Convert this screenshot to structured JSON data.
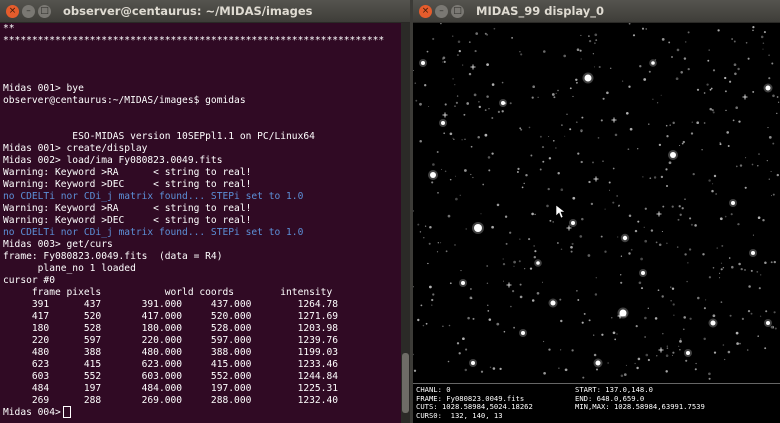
{
  "terminal": {
    "title": "observer@centaurus: ~/MIDAS/images",
    "buttons": {
      "close": "×",
      "minimize": "–",
      "maximize": "□"
    },
    "lines": [
      {
        "text": "**",
        "style": "white"
      },
      {
        "text": "******************************************************************",
        "style": "white"
      },
      {
        "text": "",
        "style": "white"
      },
      {
        "text": "",
        "style": "white"
      },
      {
        "text": "",
        "style": "white"
      },
      {
        "text": "Midas 001> bye",
        "style": "white"
      },
      {
        "text": "observer@centaurus:~/MIDAS/images$ gomidas",
        "style": "white"
      },
      {
        "text": "",
        "style": "white"
      },
      {
        "text": "",
        "style": "white"
      },
      {
        "text": "            ESO-MIDAS version 10SEPpl1.1 on PC/Linux64",
        "style": "white"
      },
      {
        "text": "Midas 001> create/display",
        "style": "white"
      },
      {
        "text": "Midas 002> load/ima Fy080823.0049.fits",
        "style": "white"
      },
      {
        "text": "Warning: Keyword >RA      < string to real!",
        "style": "white"
      },
      {
        "text": "Warning: Keyword >DEC     < string to real!",
        "style": "white"
      },
      {
        "text": "no CDELTi nor CDi_j matrix found... STEPi set to 1.0",
        "style": "blue"
      },
      {
        "text": "Warning: Keyword >RA      < string to real!",
        "style": "white"
      },
      {
        "text": "Warning: Keyword >DEC     < string to real!",
        "style": "white"
      },
      {
        "text": "no CDELTi nor CDi_j matrix found... STEPi set to 1.0",
        "style": "blue"
      },
      {
        "text": "Midas 003> get/curs",
        "style": "white"
      },
      {
        "text": "frame: Fy080823.0049.fits  (data = R4)",
        "style": "white"
      },
      {
        "text": "      plane_no 1 loaded",
        "style": "white"
      },
      {
        "text": "cursor #0",
        "style": "white"
      },
      {
        "text": "     frame pixels           world coords        intensity",
        "style": "white"
      },
      {
        "text": "     391      437       391.000     437.000        1264.78",
        "style": "white"
      },
      {
        "text": "     417      520       417.000     520.000        1271.69",
        "style": "white"
      },
      {
        "text": "     180      528       180.000     528.000        1203.98",
        "style": "white"
      },
      {
        "text": "     220      597       220.000     597.000        1239.76",
        "style": "white"
      },
      {
        "text": "     480      388       480.000     388.000        1199.03",
        "style": "white"
      },
      {
        "text": "     623      415       623.000     415.000        1233.46",
        "style": "white"
      },
      {
        "text": "     603      552       603.000     552.000        1244.84",
        "style": "white"
      },
      {
        "text": "     484      197       484.000     197.000        1225.31",
        "style": "white"
      },
      {
        "text": "     269      288       269.000     288.000        1232.40",
        "style": "white"
      }
    ],
    "prompt": "Midas 004>"
  },
  "display": {
    "title": "MIDAS_99 display_0",
    "buttons": {
      "close": "×",
      "minimize": "–",
      "maximize": "□"
    },
    "info": {
      "chanl": "CHANL: 0",
      "frame": "FRAME: Fy080823.0049.fits",
      "cuts": "CUTS: 1028.58984,5024.18262",
      "curs0": "CURS0:  132, 140, 13",
      "start": "START: 137.0,148.0",
      "end": "END: 648.0,659.0",
      "minmax": "MIN,MAX: 1028.58984,63991.7539"
    }
  }
}
